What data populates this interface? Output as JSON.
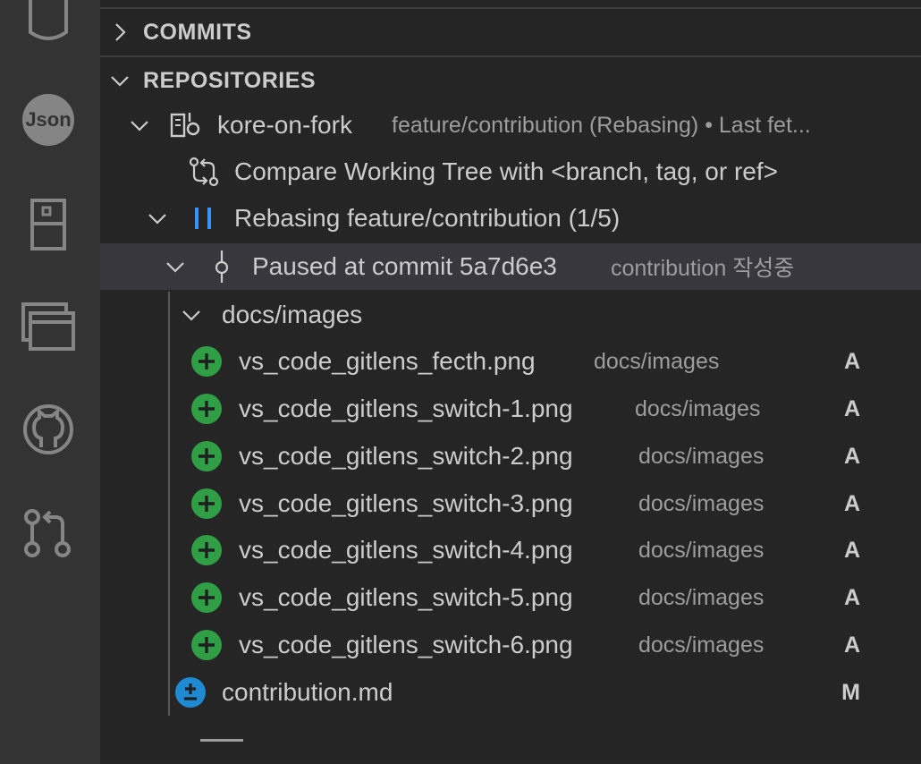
{
  "activity_bar": {
    "icons": [
      "database-icon",
      "json-icon",
      "bookmark-icon",
      "windows-icon",
      "github-icon",
      "pull-request-icon"
    ],
    "json_label": "Json"
  },
  "sections": {
    "commits": {
      "title": "COMMITS"
    },
    "repositories": {
      "title": "REPOSITORIES"
    }
  },
  "repo": {
    "name": "kore-on-fork",
    "description": "feature/contribution (Rebasing) • Last fet..."
  },
  "compare": {
    "label": "Compare Working Tree with <branch, tag, or ref>"
  },
  "rebasing": {
    "label": "Rebasing feature/contribution (1/5)"
  },
  "paused": {
    "label": "Paused at commit 5a7d6e3",
    "description": "contribution 작성중"
  },
  "folder": {
    "label": "docs/images"
  },
  "files": [
    {
      "name": "vs_code_gitlens_fecth.png",
      "path": "docs/images",
      "status": "A"
    },
    {
      "name": "vs_code_gitlens_switch-1.png",
      "path": "docs/images",
      "status": "A"
    },
    {
      "name": "vs_code_gitlens_switch-2.png",
      "path": "docs/images",
      "status": "A"
    },
    {
      "name": "vs_code_gitlens_switch-3.png",
      "path": "docs/images",
      "status": "A"
    },
    {
      "name": "vs_code_gitlens_switch-4.png",
      "path": "docs/images",
      "status": "A"
    },
    {
      "name": "vs_code_gitlens_switch-5.png",
      "path": "docs/images",
      "status": "A"
    },
    {
      "name": "vs_code_gitlens_switch-6.png",
      "path": "docs/images",
      "status": "A"
    }
  ],
  "modified_file": {
    "name": "contribution.md",
    "status": "M"
  },
  "colors": {
    "added": "#2f9e44",
    "modified": "#1f8ad2",
    "rebase_accent": "#3794ff"
  }
}
